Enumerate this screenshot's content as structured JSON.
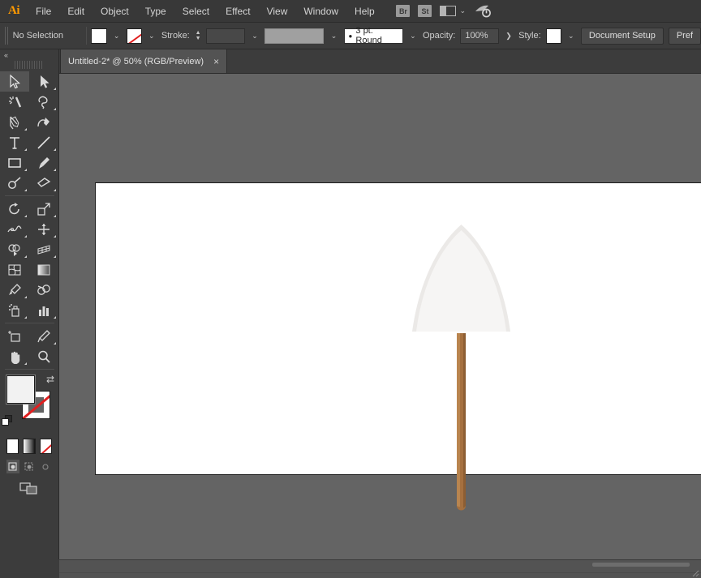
{
  "app": {
    "name": "Adobe Illustrator",
    "logo": "Ai"
  },
  "menubar": {
    "items": [
      {
        "label": "File"
      },
      {
        "label": "Edit"
      },
      {
        "label": "Object"
      },
      {
        "label": "Type"
      },
      {
        "label": "Select"
      },
      {
        "label": "Effect"
      },
      {
        "label": "View"
      },
      {
        "label": "Window"
      },
      {
        "label": "Help"
      }
    ],
    "bridge_label": "Br",
    "stock_label": "St",
    "workspace_icon": "workspace-switcher-icon",
    "chevron": "⌄",
    "search_icon": "search-help-icon"
  },
  "controlbar": {
    "selection_status": "No Selection",
    "fill_label": "Fill",
    "fill_color": "#ffffff",
    "stroke_swatch_label": "Stroke color: None",
    "stroke_label": "Stroke:",
    "stroke_weight": "",
    "stroke_profile": "",
    "brush_definition": "3 pt. Round",
    "opacity_label": "Opacity:",
    "opacity_value": "100%",
    "opacity_arrow": "❯",
    "style_label": "Style:",
    "style_color": "#ffffff",
    "document_setup_label": "Document Setup",
    "preferences_label": "Pref",
    "dropdown_glyph": "⌄"
  },
  "tabbar": {
    "document_title": "Untitled-2* @ 50% (RGB/Preview)",
    "close_glyph": "×"
  },
  "toolpanel": {
    "collapse_glyph": "«",
    "tools": [
      {
        "name": "selection-tool",
        "active": true
      },
      {
        "name": "direct-selection-tool",
        "active": false
      },
      {
        "name": "magic-wand-tool",
        "active": false
      },
      {
        "name": "lasso-tool",
        "active": false
      },
      {
        "name": "pen-tool",
        "active": false
      },
      {
        "name": "curvature-tool",
        "active": false
      },
      {
        "name": "type-tool",
        "active": false
      },
      {
        "name": "line-segment-tool",
        "active": false
      },
      {
        "name": "rectangle-tool",
        "active": false
      },
      {
        "name": "paintbrush-tool",
        "active": false
      },
      {
        "name": "shaper-tool",
        "active": false
      },
      {
        "name": "eraser-tool",
        "active": false
      },
      {
        "name": "rotate-tool",
        "active": false
      },
      {
        "name": "scale-tool",
        "active": false
      },
      {
        "name": "width-tool",
        "active": false
      },
      {
        "name": "free-transform-tool",
        "active": false
      },
      {
        "name": "shape-builder-tool",
        "active": false
      },
      {
        "name": "perspective-grid-tool",
        "active": false
      },
      {
        "name": "mesh-tool",
        "active": false
      },
      {
        "name": "gradient-tool",
        "active": false
      },
      {
        "name": "eyedropper-tool",
        "active": false
      },
      {
        "name": "blend-tool",
        "active": false
      },
      {
        "name": "symbol-sprayer-tool",
        "active": false
      },
      {
        "name": "column-graph-tool",
        "active": false
      },
      {
        "name": "artboard-tool",
        "active": false
      },
      {
        "name": "slice-tool",
        "active": false
      },
      {
        "name": "hand-tool",
        "active": false
      },
      {
        "name": "zoom-tool",
        "active": false
      }
    ],
    "fill_color": "#f2f2f2",
    "stroke_color": "none",
    "swap_glyph": "⇄",
    "color_mode_label": "Color",
    "gradient_mode_label": "Gradient",
    "none_mode_label": "None",
    "draw_modes": [
      "draw-normal",
      "draw-behind",
      "draw-inside"
    ],
    "screen_mode_label": "Change Screen Mode"
  },
  "canvas": {
    "background_color": "#646464",
    "artboard_color": "#ffffff",
    "artwork": {
      "name": "shovel",
      "blade_color": "#f6f5f4",
      "blade_edge_color": "#ebe9e7",
      "handle_color": "#a5703f",
      "handle_shadow_color": "#8d5e33",
      "handle_highlight_color": "#b9854f"
    }
  },
  "statusbar": {
    "scroll_label": "horizontal-scrollbar"
  }
}
